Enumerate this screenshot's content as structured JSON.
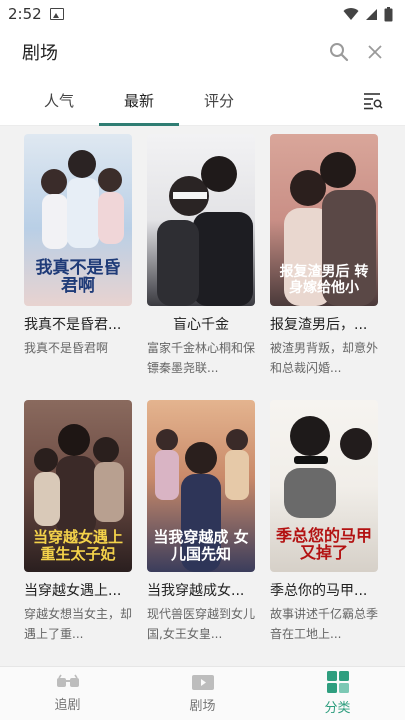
{
  "status_bar": {
    "time": "2:52"
  },
  "header": {
    "title": "剧场"
  },
  "tabs": [
    {
      "label": "人气"
    },
    {
      "label": "最新",
      "active": true
    },
    {
      "label": "评分"
    }
  ],
  "cards": [
    {
      "title": "我真不是昏君...",
      "desc": "我真不是昏君啊",
      "poster_text": "我真不是昏君啊",
      "colors": [
        "#b9cfe6",
        "#e8d3d0"
      ]
    },
    {
      "title": "盲心千金",
      "desc": "富家千金林心桐和保镖秦墨尧联...",
      "poster_text": "",
      "colors": [
        "#e9e9ec",
        "#3a3a40"
      ]
    },
    {
      "title": "报复渣男后，...",
      "desc": "被渣男背叛，却意外和总裁闪婚...",
      "poster_text": "报复渣男后 转身嫁给他小",
      "colors": [
        "#c98f86",
        "#4a3a3a"
      ]
    },
    {
      "title": "当穿越女遇上...",
      "desc": "穿越女想当女主，却遇上了重...",
      "poster_text": "当穿越女遇上重生太子妃",
      "colors": [
        "#6b4a42",
        "#2a1f1f"
      ]
    },
    {
      "title": "当我穿越成女...",
      "desc": "现代兽医穿越到女儿国,女王女皇...",
      "poster_text": "当我穿越成 女儿国先知",
      "colors": [
        "#c98a6a",
        "#3b3d5c"
      ]
    },
    {
      "title": "季总你的马甲...",
      "desc": "故事讲述千亿霸总季音在工地上...",
      "poster_text": "季总您的马甲 又掉了",
      "colors": [
        "#f1eee9",
        "#d6d0c8"
      ]
    }
  ],
  "bottom_nav": [
    {
      "label": "追剧",
      "icon": "glasses-icon"
    },
    {
      "label": "剧场",
      "icon": "tv-icon"
    },
    {
      "label": "分类",
      "icon": "grid-icon",
      "active": true
    }
  ],
  "colors": {
    "accent": "#2f7d73",
    "nav_active": "#2f9e7f"
  }
}
